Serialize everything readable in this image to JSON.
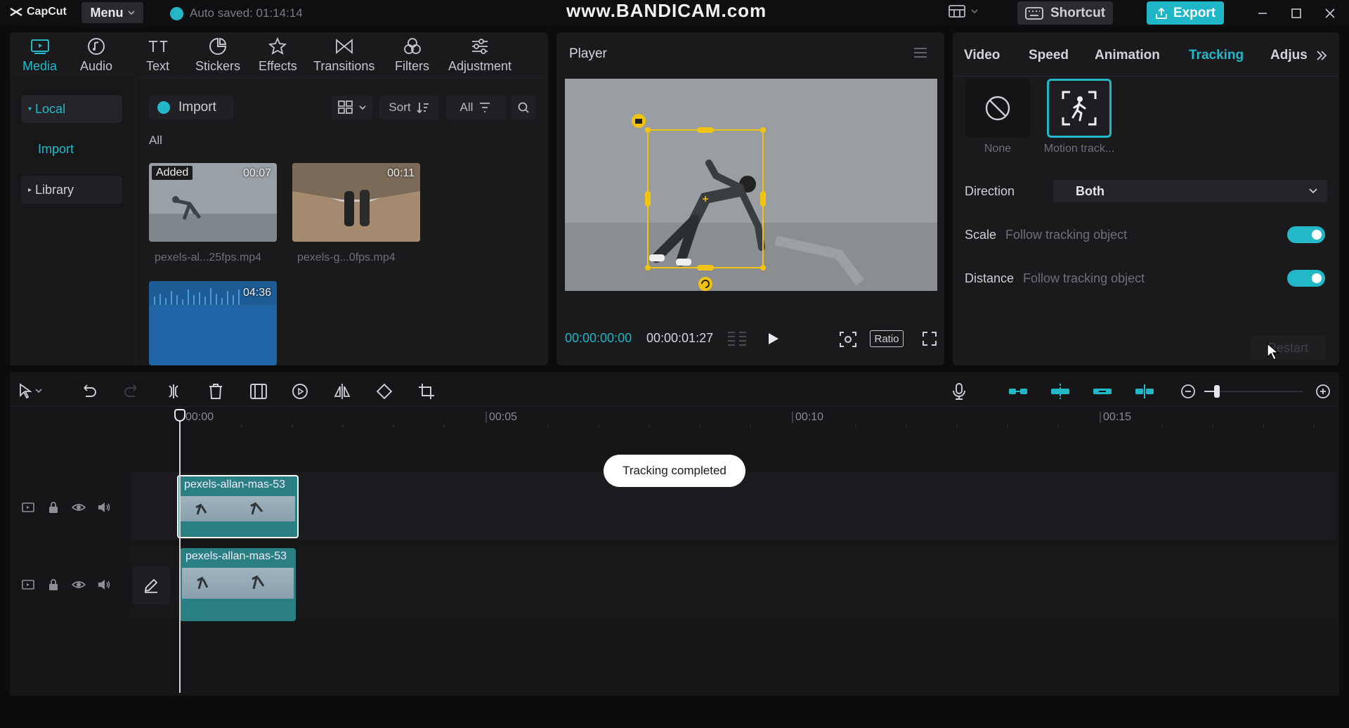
{
  "app": {
    "name": "CapCut",
    "menu_label": "Menu",
    "autosave": "Auto saved: 01:14:14"
  },
  "watermark": "www.BANDICAM.com",
  "topbar": {
    "shortcut_label": "Shortcut",
    "export_label": "Export"
  },
  "media_tabs": [
    {
      "label": "Media",
      "icon": "media-icon",
      "active": true
    },
    {
      "label": "Audio",
      "icon": "audio-icon"
    },
    {
      "label": "Text",
      "icon": "text-icon"
    },
    {
      "label": "Stickers",
      "icon": "sticker-icon"
    },
    {
      "label": "Effects",
      "icon": "effects-icon"
    },
    {
      "label": "Transitions",
      "icon": "transitions-icon"
    },
    {
      "label": "Filters",
      "icon": "filters-icon"
    },
    {
      "label": "Adjustment",
      "icon": "adjustment-icon"
    }
  ],
  "media_sidebar": {
    "local": "Local",
    "import": "Import",
    "library": "Library"
  },
  "media_toolbar": {
    "import_label": "Import",
    "sort_label": "Sort",
    "all_filter": "All",
    "all_header": "All"
  },
  "media_items": [
    {
      "badge": "Added",
      "duration": "00:07",
      "name": "pexels-al...25fps.mp4"
    },
    {
      "duration": "00:11",
      "name": "pexels-g...0fps.mp4"
    },
    {
      "duration": "04:36"
    }
  ],
  "player": {
    "title": "Player",
    "time_current": "00:00:00:00",
    "time_total": "00:00:01:27",
    "ratio_label": "Ratio"
  },
  "inspector": {
    "tabs": [
      "Video",
      "Speed",
      "Animation",
      "Tracking",
      "Adjus"
    ],
    "active_tab": "Tracking",
    "options": [
      {
        "label": "None"
      },
      {
        "label": "Motion track..."
      }
    ],
    "direction_label": "Direction",
    "direction_value": "Both",
    "scale_label": "Scale",
    "scale_sub": "Follow tracking object",
    "distance_label": "Distance",
    "distance_sub": "Follow tracking object",
    "restart_label": "Restart"
  },
  "timeline": {
    "ruler": [
      "00:00",
      "00:05",
      "00:10",
      "00:15"
    ],
    "clip_name": "pexels-allan-mas-53",
    "toast": "Tracking completed"
  },
  "colors": {
    "accent": "#22b8c8",
    "panel": "#1a1a1d",
    "background": "#0c0c0e"
  }
}
